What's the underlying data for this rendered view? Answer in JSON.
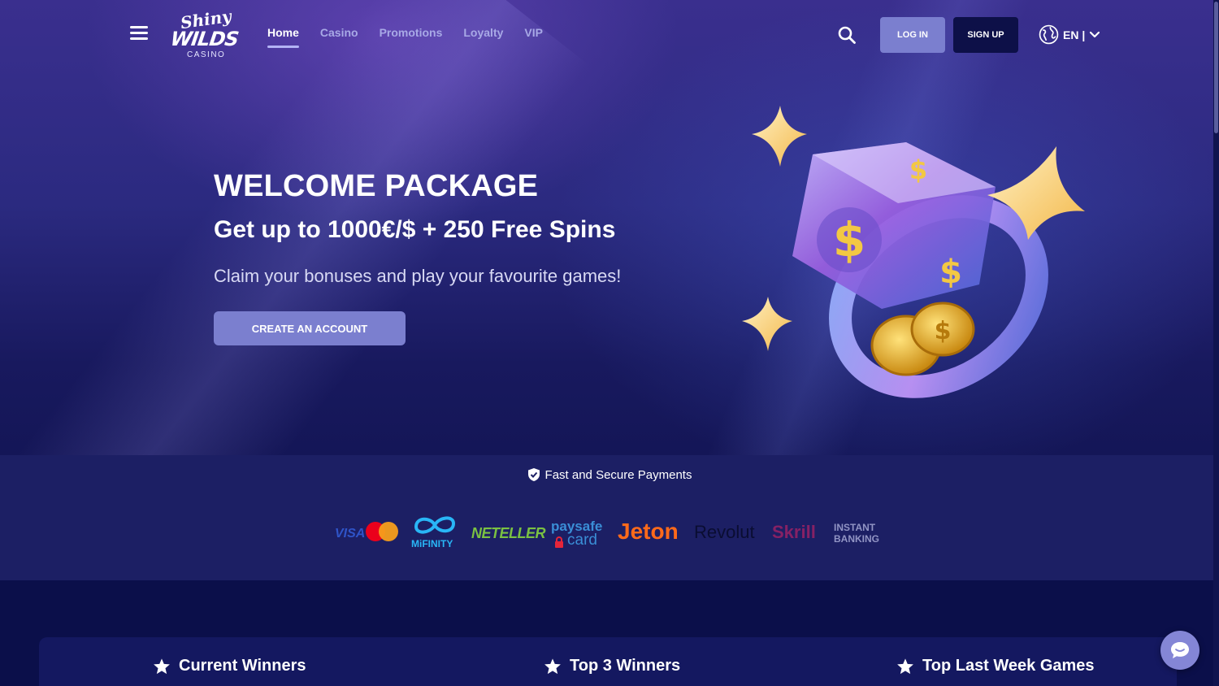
{
  "header": {
    "logo": {
      "line1": "Shiny",
      "line2": "WILDS",
      "line3": "CASINO"
    },
    "nav": [
      {
        "label": "Home",
        "active": true
      },
      {
        "label": "Casino",
        "active": false
      },
      {
        "label": "Promotions",
        "active": false
      },
      {
        "label": "Loyalty",
        "active": false
      },
      {
        "label": "VIP",
        "active": false
      }
    ],
    "login_label": "LOG IN",
    "signup_label": "SIGN UP",
    "language": "EN |"
  },
  "hero": {
    "title": "WELCOME PACKAGE",
    "subtitle": "Get up to 1000€/$ + 250 Free Spins",
    "description": "Claim your bonuses and play your favourite games!",
    "cta_label": "CREATE AN ACCOUNT"
  },
  "payments": {
    "title": "Fast and Secure Payments",
    "providers": {
      "visa": "VISA",
      "mifinity": "MiFINITY",
      "neteller": "NETELLER",
      "paysafe_top": "paysafe",
      "paysafe_bottom": "card",
      "jeton": "Jeton",
      "revolut": "Revolut",
      "skrill": "Skrill",
      "instant_top": "INSTANT",
      "instant_bottom": "BANKING"
    }
  },
  "tabs": [
    {
      "label": "Current Winners"
    },
    {
      "label": "Top 3 Winners"
    },
    {
      "label": "Top Last Week Games"
    }
  ],
  "colors": {
    "accent": "#7b7fcf",
    "page_bg": "#0b0f4a",
    "signup_bg": "#0d1048",
    "nav_inactive": "#a8a9e6"
  },
  "icons": {
    "menu": "hamburger-icon",
    "search": "search-icon",
    "globe": "globe-icon",
    "chevron": "chevron-down-icon",
    "shield": "shield-check-icon",
    "star": "star-icon",
    "chat": "chat-icon"
  }
}
